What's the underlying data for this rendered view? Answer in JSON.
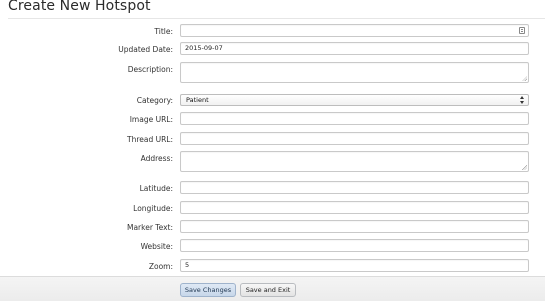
{
  "page": {
    "title": "Create New Hotspot"
  },
  "form": {
    "title": {
      "label": "Title:",
      "value": ""
    },
    "updated_date": {
      "label": "Updated Date:",
      "value": "2015-09-07"
    },
    "description": {
      "label": "Description:",
      "value": ""
    },
    "category": {
      "label": "Category:",
      "selected": "Patient"
    },
    "image_url": {
      "label": "Image URL:",
      "value": ""
    },
    "thread_url": {
      "label": "Thread URL:",
      "value": ""
    },
    "address": {
      "label": "Address:",
      "value": ""
    },
    "latitude": {
      "label": "Latitude:",
      "value": ""
    },
    "longitude": {
      "label": "Longitude:",
      "value": ""
    },
    "marker_text": {
      "label": "Marker Text:",
      "value": ""
    },
    "website": {
      "label": "Website:",
      "value": ""
    },
    "zoom": {
      "label": "Zoom:",
      "value": "5"
    }
  },
  "actions": {
    "save_changes": "Save Changes",
    "save_and_exit": "Save and Exit"
  },
  "colors": {
    "primary_button": "#c7d7ea",
    "field_border": "#c9c9c9"
  }
}
